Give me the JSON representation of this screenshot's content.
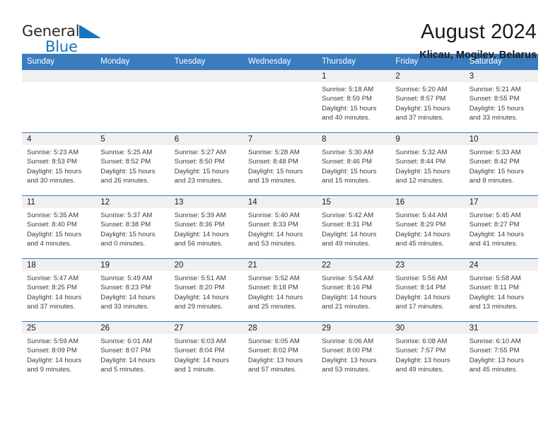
{
  "brand": {
    "word1": "General",
    "word2": "Blue",
    "triangle_color": "#1576bc",
    "word1_color": "#2b2b2b",
    "word2_color": "#1576bc"
  },
  "header": {
    "title": "August 2024",
    "subtitle": "Klicau, Mogilev, Belarus"
  },
  "theme": {
    "header_bg": "#3a7cbe",
    "header_text": "#ffffff",
    "daynum_bg": "#f0f0f0",
    "row_border": "#3a7cbe",
    "body_text": "#3c3c3c"
  },
  "weekday_headers": [
    "Sunday",
    "Monday",
    "Tuesday",
    "Wednesday",
    "Thursday",
    "Friday",
    "Saturday"
  ],
  "labels": {
    "sunrise_prefix": "Sunrise:",
    "sunset_prefix": "Sunset:",
    "daylight_prefix": "Daylight:"
  },
  "weeks": [
    [
      {
        "day": "",
        "empty": true
      },
      {
        "day": "",
        "empty": true
      },
      {
        "day": "",
        "empty": true
      },
      {
        "day": "",
        "empty": true
      },
      {
        "day": "1",
        "sunrise": "Sunrise: 5:18 AM",
        "sunset": "Sunset: 8:59 PM",
        "daylight_line1": "Daylight: 15 hours",
        "daylight_line2": "and 40 minutes."
      },
      {
        "day": "2",
        "sunrise": "Sunrise: 5:20 AM",
        "sunset": "Sunset: 8:57 PM",
        "daylight_line1": "Daylight: 15 hours",
        "daylight_line2": "and 37 minutes."
      },
      {
        "day": "3",
        "sunrise": "Sunrise: 5:21 AM",
        "sunset": "Sunset: 8:55 PM",
        "daylight_line1": "Daylight: 15 hours",
        "daylight_line2": "and 33 minutes."
      }
    ],
    [
      {
        "day": "4",
        "sunrise": "Sunrise: 5:23 AM",
        "sunset": "Sunset: 8:53 PM",
        "daylight_line1": "Daylight: 15 hours",
        "daylight_line2": "and 30 minutes."
      },
      {
        "day": "5",
        "sunrise": "Sunrise: 5:25 AM",
        "sunset": "Sunset: 8:52 PM",
        "daylight_line1": "Daylight: 15 hours",
        "daylight_line2": "and 26 minutes."
      },
      {
        "day": "6",
        "sunrise": "Sunrise: 5:27 AM",
        "sunset": "Sunset: 8:50 PM",
        "daylight_line1": "Daylight: 15 hours",
        "daylight_line2": "and 23 minutes."
      },
      {
        "day": "7",
        "sunrise": "Sunrise: 5:28 AM",
        "sunset": "Sunset: 8:48 PM",
        "daylight_line1": "Daylight: 15 hours",
        "daylight_line2": "and 19 minutes."
      },
      {
        "day": "8",
        "sunrise": "Sunrise: 5:30 AM",
        "sunset": "Sunset: 8:46 PM",
        "daylight_line1": "Daylight: 15 hours",
        "daylight_line2": "and 15 minutes."
      },
      {
        "day": "9",
        "sunrise": "Sunrise: 5:32 AM",
        "sunset": "Sunset: 8:44 PM",
        "daylight_line1": "Daylight: 15 hours",
        "daylight_line2": "and 12 minutes."
      },
      {
        "day": "10",
        "sunrise": "Sunrise: 5:33 AM",
        "sunset": "Sunset: 8:42 PM",
        "daylight_line1": "Daylight: 15 hours",
        "daylight_line2": "and 8 minutes."
      }
    ],
    [
      {
        "day": "11",
        "sunrise": "Sunrise: 5:35 AM",
        "sunset": "Sunset: 8:40 PM",
        "daylight_line1": "Daylight: 15 hours",
        "daylight_line2": "and 4 minutes."
      },
      {
        "day": "12",
        "sunrise": "Sunrise: 5:37 AM",
        "sunset": "Sunset: 8:38 PM",
        "daylight_line1": "Daylight: 15 hours",
        "daylight_line2": "and 0 minutes."
      },
      {
        "day": "13",
        "sunrise": "Sunrise: 5:39 AM",
        "sunset": "Sunset: 8:36 PM",
        "daylight_line1": "Daylight: 14 hours",
        "daylight_line2": "and 56 minutes."
      },
      {
        "day": "14",
        "sunrise": "Sunrise: 5:40 AM",
        "sunset": "Sunset: 8:33 PM",
        "daylight_line1": "Daylight: 14 hours",
        "daylight_line2": "and 53 minutes."
      },
      {
        "day": "15",
        "sunrise": "Sunrise: 5:42 AM",
        "sunset": "Sunset: 8:31 PM",
        "daylight_line1": "Daylight: 14 hours",
        "daylight_line2": "and 49 minutes."
      },
      {
        "day": "16",
        "sunrise": "Sunrise: 5:44 AM",
        "sunset": "Sunset: 8:29 PM",
        "daylight_line1": "Daylight: 14 hours",
        "daylight_line2": "and 45 minutes."
      },
      {
        "day": "17",
        "sunrise": "Sunrise: 5:45 AM",
        "sunset": "Sunset: 8:27 PM",
        "daylight_line1": "Daylight: 14 hours",
        "daylight_line2": "and 41 minutes."
      }
    ],
    [
      {
        "day": "18",
        "sunrise": "Sunrise: 5:47 AM",
        "sunset": "Sunset: 8:25 PM",
        "daylight_line1": "Daylight: 14 hours",
        "daylight_line2": "and 37 minutes."
      },
      {
        "day": "19",
        "sunrise": "Sunrise: 5:49 AM",
        "sunset": "Sunset: 8:23 PM",
        "daylight_line1": "Daylight: 14 hours",
        "daylight_line2": "and 33 minutes."
      },
      {
        "day": "20",
        "sunrise": "Sunrise: 5:51 AM",
        "sunset": "Sunset: 8:20 PM",
        "daylight_line1": "Daylight: 14 hours",
        "daylight_line2": "and 29 minutes."
      },
      {
        "day": "21",
        "sunrise": "Sunrise: 5:52 AM",
        "sunset": "Sunset: 8:18 PM",
        "daylight_line1": "Daylight: 14 hours",
        "daylight_line2": "and 25 minutes."
      },
      {
        "day": "22",
        "sunrise": "Sunrise: 5:54 AM",
        "sunset": "Sunset: 8:16 PM",
        "daylight_line1": "Daylight: 14 hours",
        "daylight_line2": "and 21 minutes."
      },
      {
        "day": "23",
        "sunrise": "Sunrise: 5:56 AM",
        "sunset": "Sunset: 8:14 PM",
        "daylight_line1": "Daylight: 14 hours",
        "daylight_line2": "and 17 minutes."
      },
      {
        "day": "24",
        "sunrise": "Sunrise: 5:58 AM",
        "sunset": "Sunset: 8:11 PM",
        "daylight_line1": "Daylight: 14 hours",
        "daylight_line2": "and 13 minutes."
      }
    ],
    [
      {
        "day": "25",
        "sunrise": "Sunrise: 5:59 AM",
        "sunset": "Sunset: 8:09 PM",
        "daylight_line1": "Daylight: 14 hours",
        "daylight_line2": "and 9 minutes."
      },
      {
        "day": "26",
        "sunrise": "Sunrise: 6:01 AM",
        "sunset": "Sunset: 8:07 PM",
        "daylight_line1": "Daylight: 14 hours",
        "daylight_line2": "and 5 minutes."
      },
      {
        "day": "27",
        "sunrise": "Sunrise: 6:03 AM",
        "sunset": "Sunset: 8:04 PM",
        "daylight_line1": "Daylight: 14 hours",
        "daylight_line2": "and 1 minute."
      },
      {
        "day": "28",
        "sunrise": "Sunrise: 6:05 AM",
        "sunset": "Sunset: 8:02 PM",
        "daylight_line1": "Daylight: 13 hours",
        "daylight_line2": "and 57 minutes."
      },
      {
        "day": "29",
        "sunrise": "Sunrise: 6:06 AM",
        "sunset": "Sunset: 8:00 PM",
        "daylight_line1": "Daylight: 13 hours",
        "daylight_line2": "and 53 minutes."
      },
      {
        "day": "30",
        "sunrise": "Sunrise: 6:08 AM",
        "sunset": "Sunset: 7:57 PM",
        "daylight_line1": "Daylight: 13 hours",
        "daylight_line2": "and 49 minutes."
      },
      {
        "day": "31",
        "sunrise": "Sunrise: 6:10 AM",
        "sunset": "Sunset: 7:55 PM",
        "daylight_line1": "Daylight: 13 hours",
        "daylight_line2": "and 45 minutes."
      }
    ]
  ]
}
